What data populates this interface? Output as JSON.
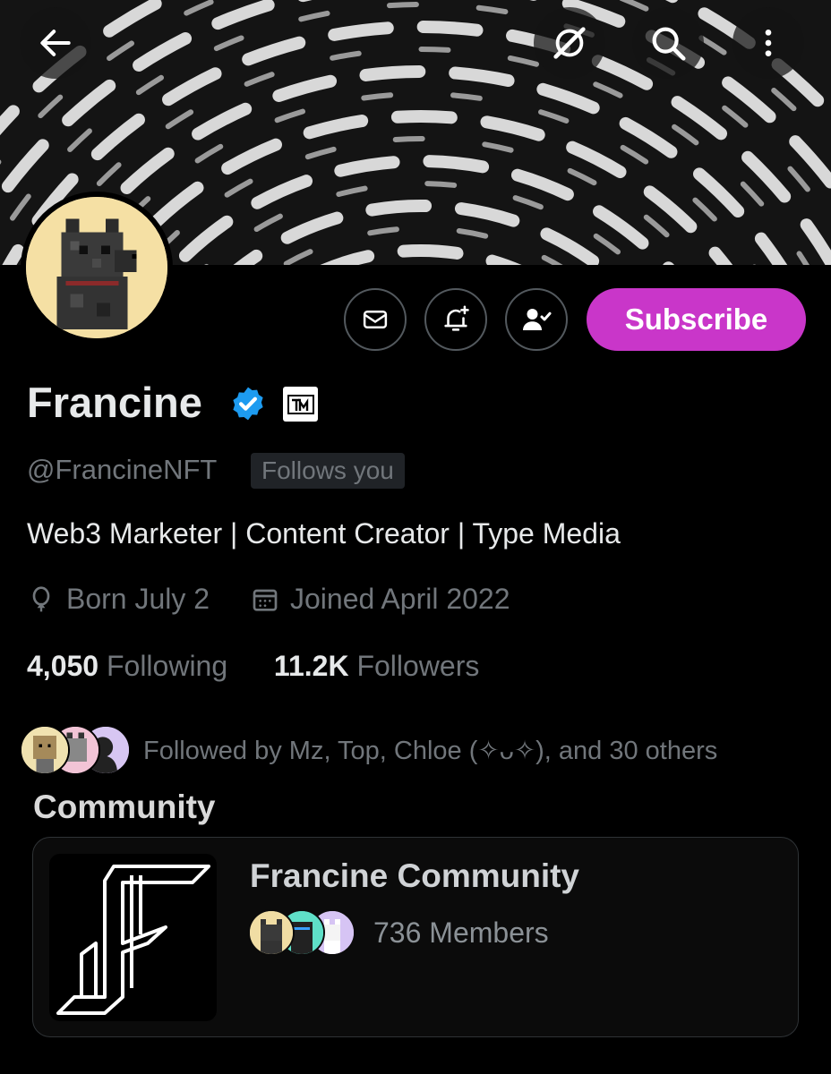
{
  "header": {
    "back_icon": "arrow-left-icon",
    "grok_icon": "grok-icon",
    "search_icon": "search-icon",
    "more_icon": "more-vertical-icon"
  },
  "profile": {
    "name": "Francine",
    "handle": "@FrancineNFT",
    "follows_you": "Follows you",
    "bio": "Web3 Marketer | Content Creator | Type Media",
    "birthday": "Born July 2",
    "joined": "Joined April 2022",
    "following_count": "4,050",
    "following_label": "Following",
    "followers_count": "11.2K",
    "followers_label": "Followers",
    "followed_by": "Followed by Mz, Top, Chloe (✧ᴗ✧), and 30 others",
    "affiliate_badge_text": "TM"
  },
  "actions": {
    "subscribe_label": "Subscribe",
    "message_icon": "mail-icon",
    "notify_icon": "bell-plus-icon",
    "following_icon": "person-check-icon"
  },
  "community": {
    "section_title": "Community",
    "name": "Francine Community",
    "members": "736 Members"
  },
  "colors": {
    "accent": "#c936c9",
    "verified": "#1d9bf0",
    "muted": "#71767b",
    "text": "#e7e9ea"
  }
}
